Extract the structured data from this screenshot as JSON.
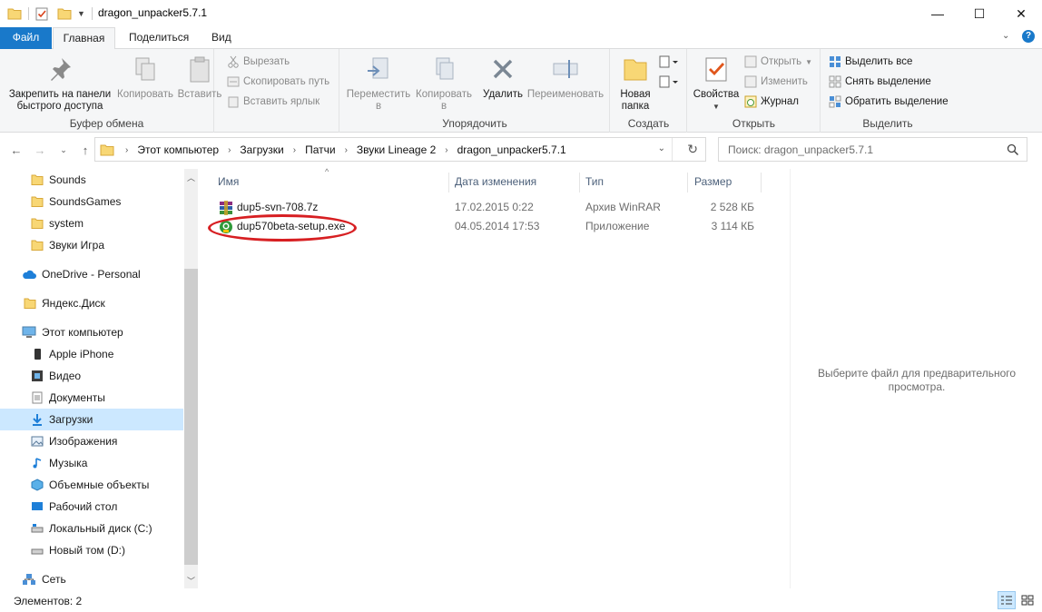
{
  "window": {
    "title": "dragon_unpacker5.7.1",
    "minimize": "—",
    "maximize": "☐",
    "close": "✕"
  },
  "tabs": {
    "file": "Файл",
    "home": "Главная",
    "share": "Поделиться",
    "view": "Вид"
  },
  "ribbon": {
    "clipboard": {
      "label": "Буфер обмена",
      "pin_line1": "Закрепить на панели",
      "pin_line2": "быстрого доступа",
      "copy": "Копировать",
      "paste": "Вставить",
      "cut": "Вырезать",
      "copy_path": "Скопировать путь",
      "paste_shortcut": "Вставить ярлык"
    },
    "organize": {
      "label": "Упорядочить",
      "move_line1": "Переместить",
      "move_line2": "в",
      "copy_line1": "Копировать",
      "copy_line2": "в",
      "delete": "Удалить",
      "rename": "Переименовать"
    },
    "create": {
      "label": "Создать",
      "new_folder_line1": "Новая",
      "new_folder_line2": "папка"
    },
    "open": {
      "label": "Открыть",
      "properties": "Свойства",
      "open": "Открыть",
      "edit": "Изменить",
      "history": "Журнал"
    },
    "select": {
      "label": "Выделить",
      "select_all": "Выделить все",
      "select_none": "Снять выделение",
      "invert": "Обратить выделение"
    }
  },
  "address": {
    "crumbs": [
      "Этот компьютер",
      "Загрузки",
      "Патчи",
      "Звуки Lineage 2",
      "dragon_unpacker5.7.1"
    ],
    "search_placeholder": "Поиск: dragon_unpacker5.7.1"
  },
  "nav": {
    "items": [
      {
        "label": "Sounds",
        "icon": "folder-icon"
      },
      {
        "label": "SoundsGames",
        "icon": "folder-icon"
      },
      {
        "label": "system",
        "icon": "folder-icon"
      },
      {
        "label": "Звуки Игра",
        "icon": "folder-icon"
      },
      {
        "label": "OneDrive - Personal",
        "icon": "cloud-icon"
      },
      {
        "label": "Яндекс.Диск",
        "icon": "folder-icon"
      },
      {
        "label": "Этот компьютер",
        "icon": "computer-icon"
      },
      {
        "label": "Apple iPhone",
        "icon": "phone-icon"
      },
      {
        "label": "Видео",
        "icon": "video-icon"
      },
      {
        "label": "Документы",
        "icon": "documents-icon"
      },
      {
        "label": "Загрузки",
        "icon": "downloads-icon"
      },
      {
        "label": "Изображения",
        "icon": "pictures-icon"
      },
      {
        "label": "Музыка",
        "icon": "music-icon"
      },
      {
        "label": "Объемные объекты",
        "icon": "3d-objects-icon"
      },
      {
        "label": "Рабочий стол",
        "icon": "desktop-icon"
      },
      {
        "label": "Локальный диск (C:)",
        "icon": "drive-icon"
      },
      {
        "label": "Новый том (D:)",
        "icon": "drive-icon"
      },
      {
        "label": "Сеть",
        "icon": "network-icon"
      }
    ]
  },
  "columns": {
    "name": "Имя",
    "date": "Дата изменения",
    "type": "Тип",
    "size": "Размер"
  },
  "files": [
    {
      "name": "dup5-svn-708.7z",
      "date": "17.02.2015 0:22",
      "type": "Архив WinRAR",
      "size": "2 528 КБ",
      "icon": "winrar-archive-icon"
    },
    {
      "name": "dup570beta-setup.exe",
      "date": "04.05.2014 17:53",
      "type": "Приложение",
      "size": "3 114 КБ",
      "icon": "installer-app-icon"
    }
  ],
  "preview": {
    "line1": "Выберите файл для предварительного",
    "line2": "просмотра."
  },
  "status": {
    "items_count": "Элементов: 2"
  },
  "colors": {
    "accent": "#1979ca",
    "selection": "#cce8ff",
    "annotation": "#d71f22"
  }
}
